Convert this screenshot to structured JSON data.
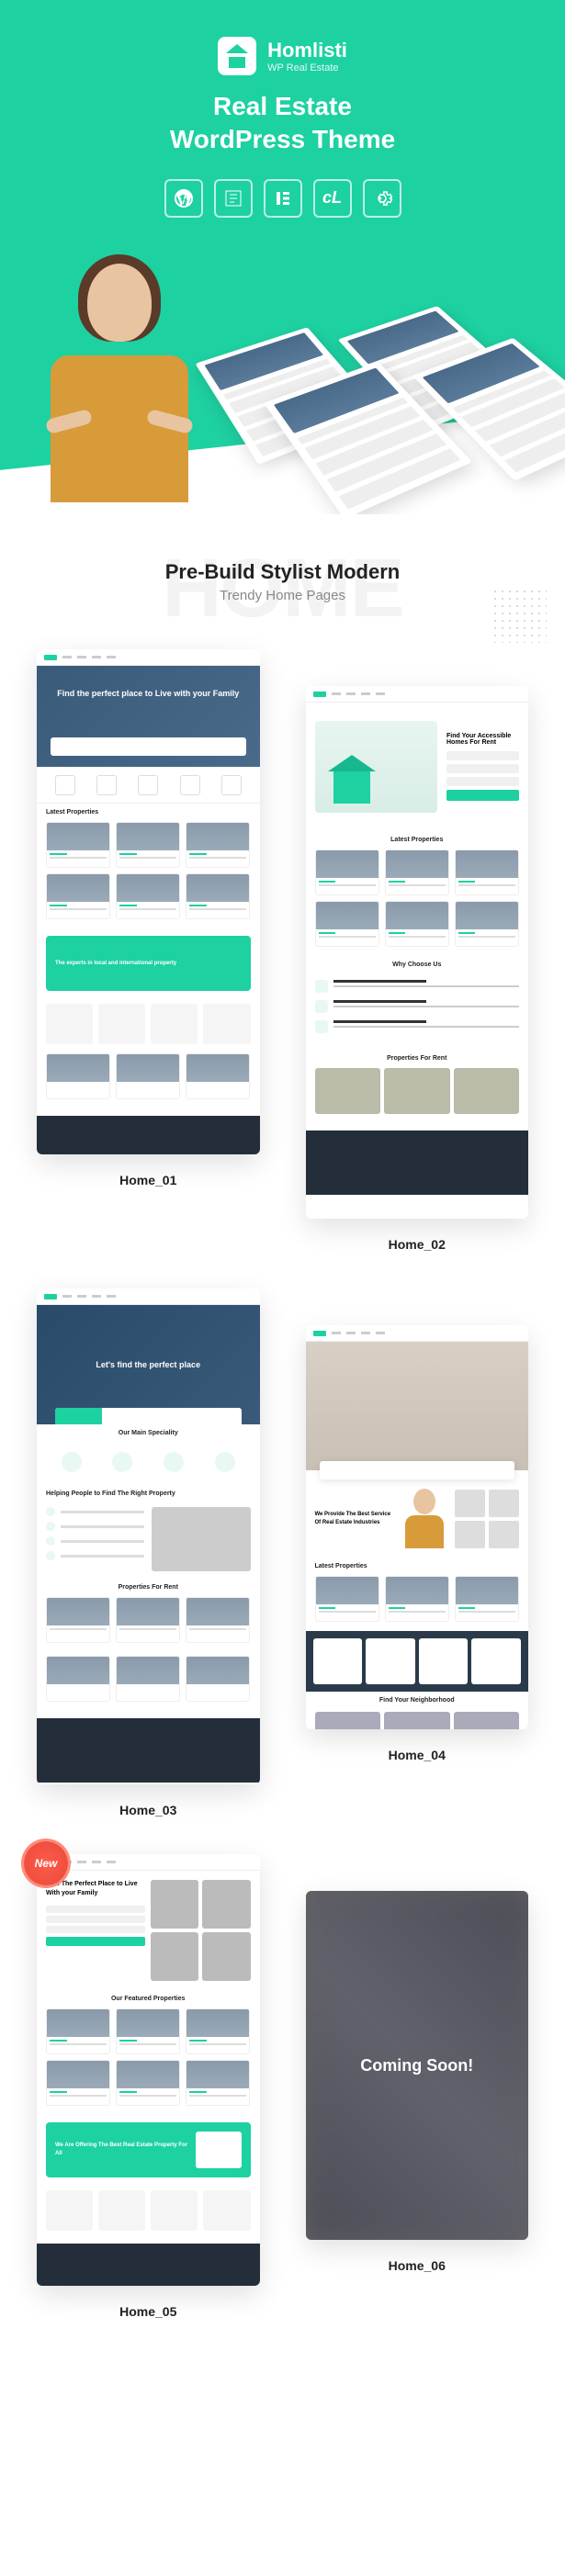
{
  "hero": {
    "logo_title": "Homlisti",
    "logo_sub": "WP Real Estate",
    "title_line1": "Real Estate",
    "title_line2": "WordPress Theme"
  },
  "section": {
    "bg_text": "HOME",
    "title": "Pre-Build Stylist Modern",
    "sub": "Trendy Home Pages"
  },
  "thumbs": {
    "home01": {
      "label": "Home_01",
      "hero_text": "Find the perfect place to\nLive with your Family",
      "section1": "Latest Properties",
      "banner": "The experts in local and international property"
    },
    "home02": {
      "label": "Home_02",
      "search_title": "Find Your Accessible Homes For Rent",
      "section1": "Latest Properties",
      "section2": "Why Choose Us",
      "section3": "Properties For Rent"
    },
    "home03": {
      "label": "Home_03",
      "hero_text": "Let's find the perfect place",
      "section1": "Our Main Speciality",
      "section2": "Helping People to Find The Right Property",
      "section3": "Properties For Rent"
    },
    "home04": {
      "label": "Home_04",
      "section1": "We Provide The Best Service Of Real Estate Industries",
      "section2": "Latest Properties",
      "section3": "Find Your Neighborhood"
    },
    "home05": {
      "label": "Home_05",
      "badge": "New",
      "hero_text": "Find The Perfect Place to Live With your Family",
      "section1": "Our Featured Properties",
      "banner": "We Are Offering The Best Real Estate Property For All"
    },
    "home06": {
      "label": "Home_06",
      "overlay": "Coming Soon!"
    }
  }
}
